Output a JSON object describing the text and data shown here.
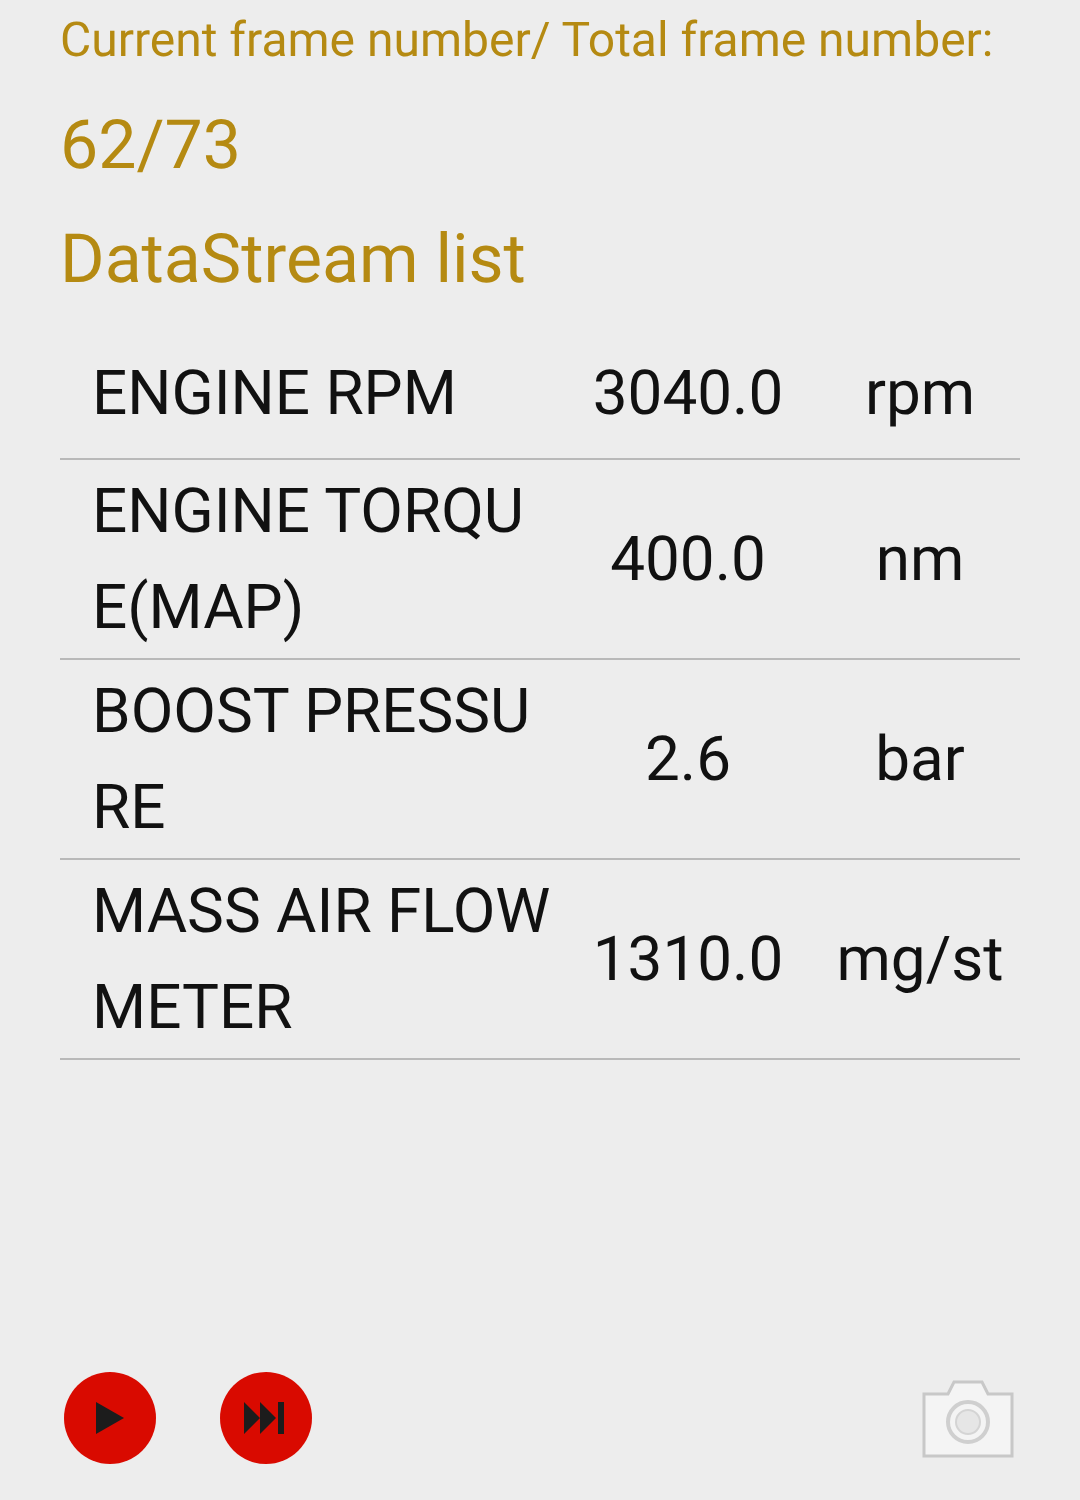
{
  "frame_label": "Current frame number/ Total frame number:",
  "frame_value": "62/73",
  "list_title": "DataStream list",
  "rows": [
    {
      "name": "ENGINE RPM",
      "value": "3040.0",
      "unit": "rpm"
    },
    {
      "name": "ENGINE TORQUE(MAP)",
      "value": "400.0",
      "unit": "nm"
    },
    {
      "name": "BOOST PRESSURE",
      "value": "2.6",
      "unit": "bar"
    },
    {
      "name": "MASS AIR FLOW METER",
      "value": "1310.0",
      "unit": "mg/st"
    }
  ],
  "controls": [
    {
      "kind": "play"
    },
    {
      "kind": "next"
    },
    {
      "kind": "camera"
    }
  ]
}
